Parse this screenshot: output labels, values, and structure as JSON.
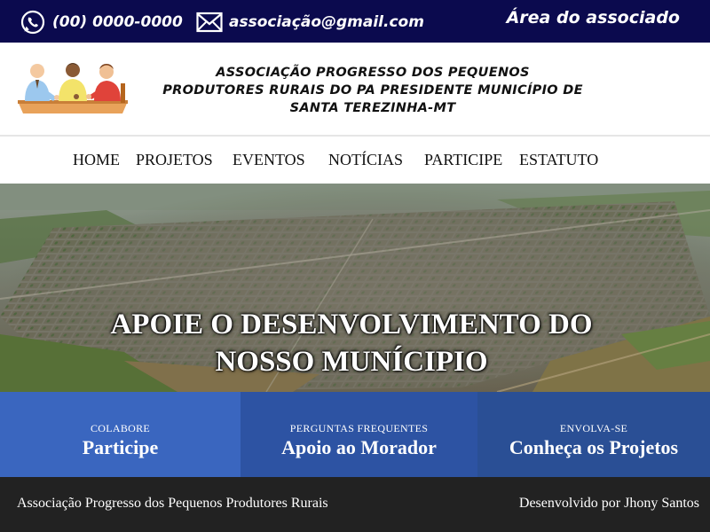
{
  "colors": {
    "topbar_bg": "#0b0a4e",
    "footer_bg": "#222222",
    "card_1": "#3a66bf",
    "card_2": "#2d53a3",
    "card_3": "#2a4f95"
  },
  "topbar": {
    "phone": "(00) 0000-0000",
    "phone_icon": "whatsapp-icon",
    "email": "associação@gmail.com",
    "email_icon": "envelope-icon",
    "member_area": "Área do associado"
  },
  "header": {
    "logo_icon": "meeting-people-illustration",
    "org_name_lines": [
      "ASSOCIAÇÃO PROGRESSO DOS PEQUENOS",
      "PRODUTORES RURAIS DO PA PRESIDENTE MUNICÍPIO DE",
      "SANTA TEREZINHA-MT"
    ]
  },
  "nav": {
    "items": [
      {
        "label": "HOME"
      },
      {
        "label": "PROJETOS"
      },
      {
        "label": "EVENTOS"
      },
      {
        "label": "NOTÍCIAS"
      },
      {
        "label": "PARTICIPE"
      },
      {
        "label": "ESTATUTO"
      }
    ]
  },
  "hero": {
    "title_lines": [
      "APOIE O DESENVOLVIMENTO DO",
      "NOSSO MUNÍCIPIO"
    ]
  },
  "cards": [
    {
      "eyebrow": "COLABORE",
      "title": "Participe"
    },
    {
      "eyebrow": "PERGUNTAS FREQUENTES",
      "title": "Apoio ao Morador"
    },
    {
      "eyebrow": "ENVOLVA-SE",
      "title": "Conheça os Projetos"
    }
  ],
  "footer": {
    "left": "Associação Progresso dos Pequenos Produtores Rurais",
    "right": "Desenvolvido por Jhony Santos"
  }
}
